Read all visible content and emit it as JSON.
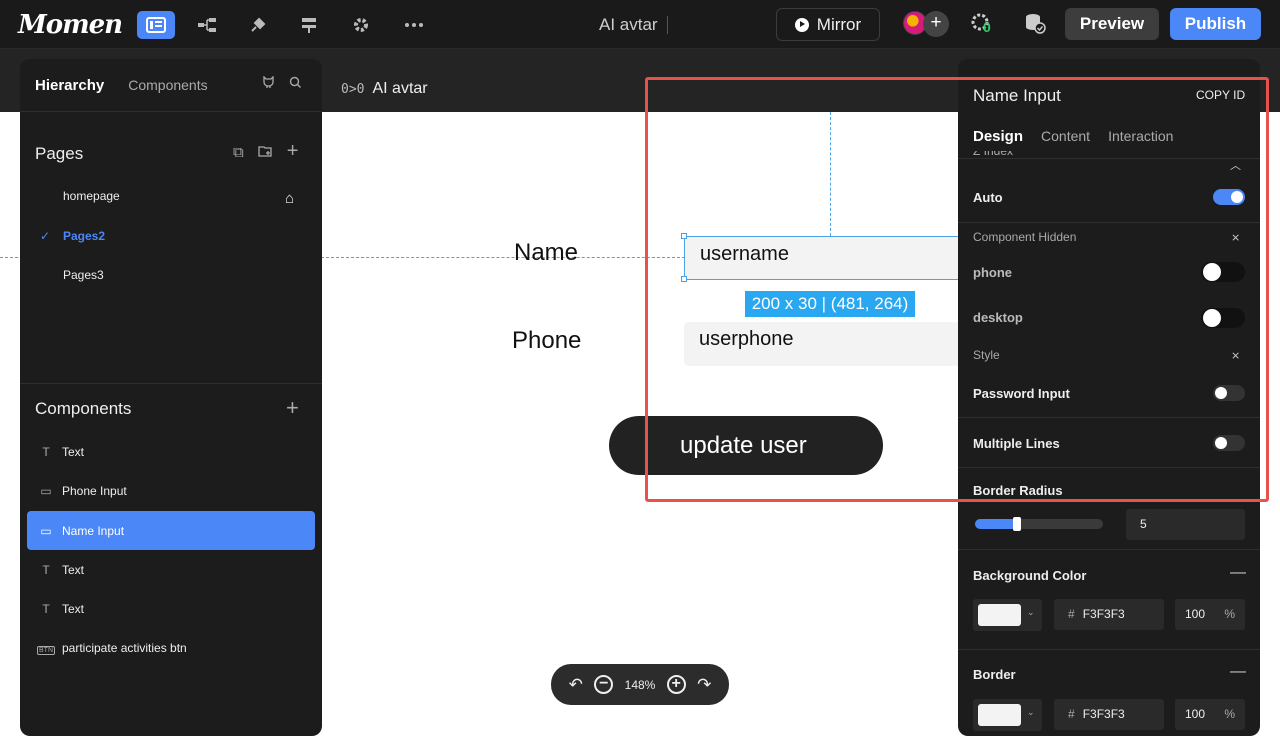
{
  "app": {
    "logo": "Momen",
    "doc_title": "AI avtar",
    "mirror_label": "Mirror",
    "preview_label": "Preview",
    "publish_label": "Publish",
    "debug_badge": "0"
  },
  "canvas": {
    "page_tag": "0>0",
    "page_name": "AI avtar",
    "name_label": "Name",
    "phone_label": "Phone",
    "name_input_value": "username",
    "phone_input_value": "userphone",
    "size_tag": "200 x 30 | (481, 264)",
    "update_button": "update user",
    "zoom": "148%"
  },
  "left": {
    "tab_hierarchy": "Hierarchy",
    "tab_components": "Components",
    "pages_title": "Pages",
    "pages": [
      "homepage",
      "Pages2",
      "Pages3"
    ],
    "components_title": "Components",
    "components": [
      "Text",
      "Phone Input",
      "Name Input",
      "Text",
      "Text",
      "participate activities btn"
    ],
    "btn_icon_text": "BTN"
  },
  "right": {
    "title": "Name Input",
    "copy_id": "COPY ID",
    "tab_design": "Design",
    "tab_content": "Content",
    "tab_interaction": "Interaction",
    "z_index_label": "Z Index",
    "auto_label": "Auto",
    "component_hidden_label": "Component Hidden",
    "phone_label": "phone",
    "desktop_label": "desktop",
    "style_label": "Style",
    "password_input_label": "Password Input",
    "multiple_lines_label": "Multiple Lines",
    "border_radius_label": "Border Radius",
    "border_radius_value": "5",
    "border_radius_fraction": 0.33,
    "bg_color_label": "Background Color",
    "bg_hex": "F3F3F3",
    "bg_opacity": "100",
    "percent": "%",
    "hash": "#",
    "border_label": "Border",
    "border_hex": "F3F3F3",
    "border_opacity": "100"
  },
  "colors": {
    "accent": "#4b87f6",
    "highlight": "#e5534b",
    "guide": "#4aa3e8",
    "input_bg": "#f3f3f3"
  }
}
